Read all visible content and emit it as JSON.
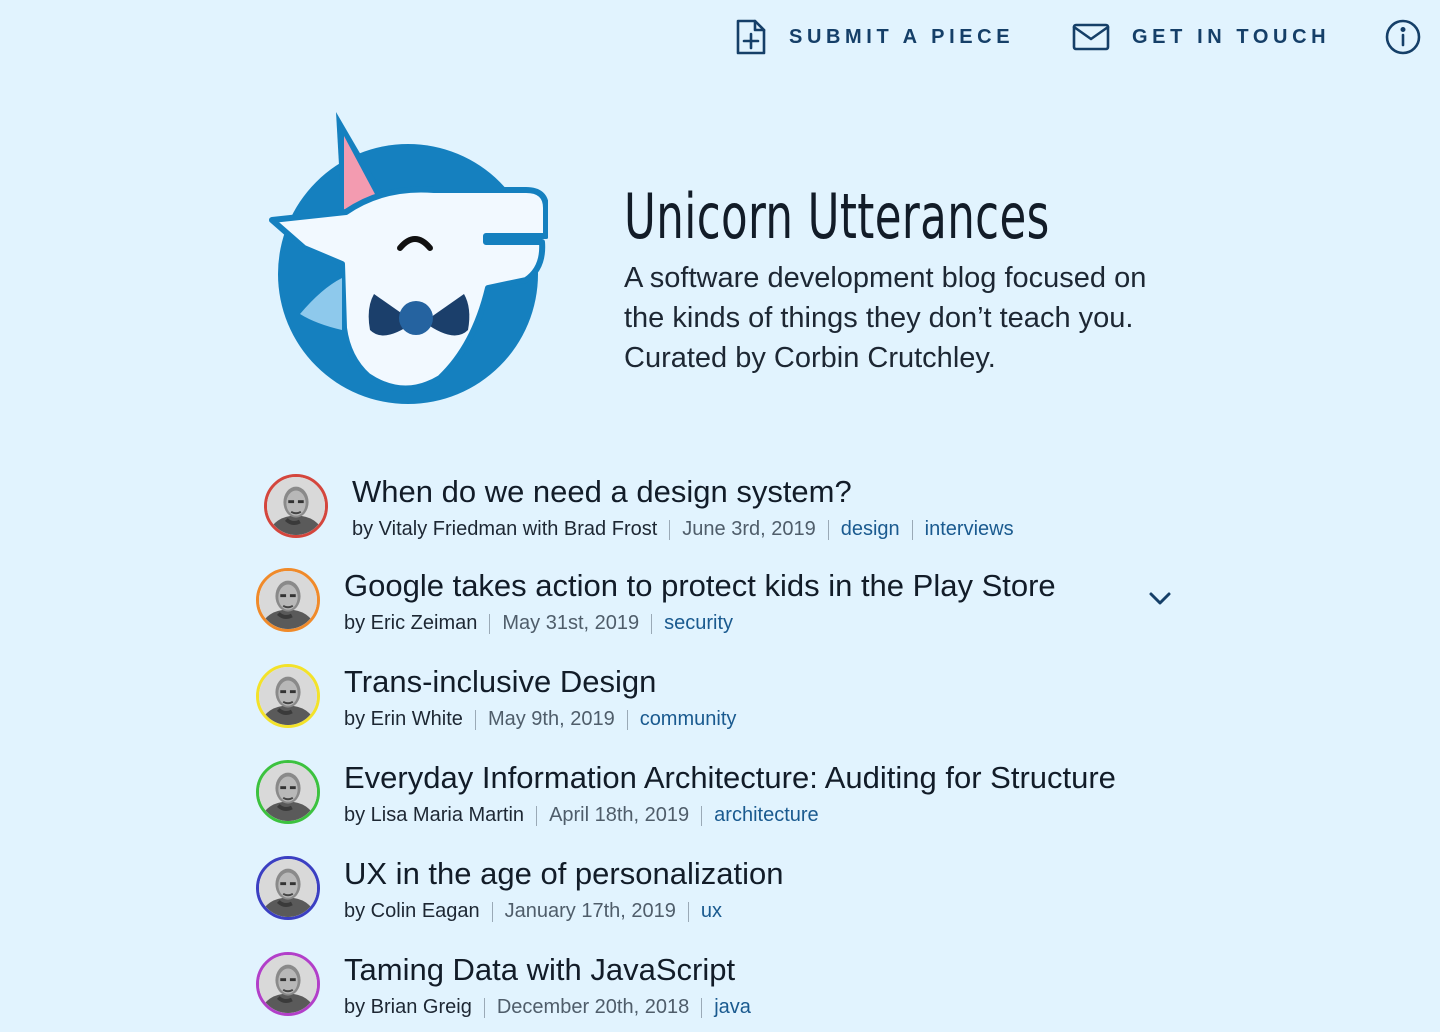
{
  "nav": {
    "submit_label": "SUBMIT A PIECE",
    "contact_label": "GET IN TOUCH",
    "submit_icon": "file-plus-icon",
    "contact_icon": "mail-icon",
    "info_icon": "info-icon"
  },
  "site": {
    "title": "Unicorn Utterances",
    "description": "A software development blog focused on the kinds of things they don’t teach you. Curated by Corbin Crutchley."
  },
  "colors": {
    "background": "#e1f3fe",
    "nav": "#153f68",
    "logo_blue": "#1580bf",
    "tag": "#1a5a8f"
  },
  "posts": [
    {
      "title": "When do we need a design system?",
      "author": "by Vitaly Friedman with Brad Frost",
      "date": "June 3rd, 2019",
      "tags": [
        "design",
        "interviews"
      ],
      "ring": "#d4463d"
    },
    {
      "title": "Google takes action to protect kids in the Play Store",
      "author": "by Eric Zeiman",
      "date": "May 31st, 2019",
      "tags": [
        "security"
      ],
      "ring": "#f08a2a"
    },
    {
      "title": "Trans-inclusive Design",
      "author": "by Erin White",
      "date": "May 9th, 2019",
      "tags": [
        "community"
      ],
      "ring": "#f3e22a"
    },
    {
      "title": "Everyday Information Architecture: Auditing for Structure",
      "author": "by Lisa Maria Martin",
      "date": "April 18th, 2019",
      "tags": [
        "architecture"
      ],
      "ring": "#3cc23f"
    },
    {
      "title": "UX in the age of personalization",
      "author": "by Colin Eagan",
      "date": "January 17th, 2019",
      "tags": [
        "ux"
      ],
      "ring": "#3b3fc2"
    },
    {
      "title": "Taming Data with JavaScript",
      "author": "by Brian Greig",
      "date": "December 20th, 2018",
      "tags": [
        "java"
      ],
      "ring": "#b23fc9"
    }
  ]
}
